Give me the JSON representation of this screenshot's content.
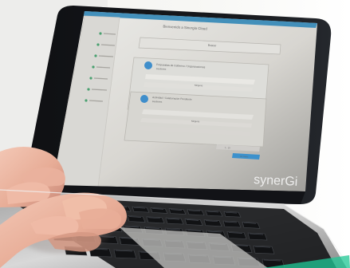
{
  "screen": {
    "title": "Bienvenido a Sinergia Cloud",
    "search_placeholder": "Buscar",
    "section_1_title": "Propuestas de Gobierno / Organizaciones",
    "section_1_subtitle": "Gestiones",
    "section_2_title": "Actividad / Colaboración Pendiente",
    "section_2_subtitle": "Gestiones",
    "empty_message": "Ninguno",
    "pagination": "1 - 10",
    "footer_button": "Ver todos"
  },
  "brand": {
    "logo_text": "synerGi"
  },
  "colors": {
    "screen_bg": "#d6d4cf",
    "sidebar_bg": "#d9d8d4",
    "header_bar": "#3a8bb8",
    "accent": "#2f8ecf",
    "laptop_body": "#c8c8c8"
  },
  "icons": {
    "hands": "typing-hands",
    "brand": "synergi-logo"
  }
}
